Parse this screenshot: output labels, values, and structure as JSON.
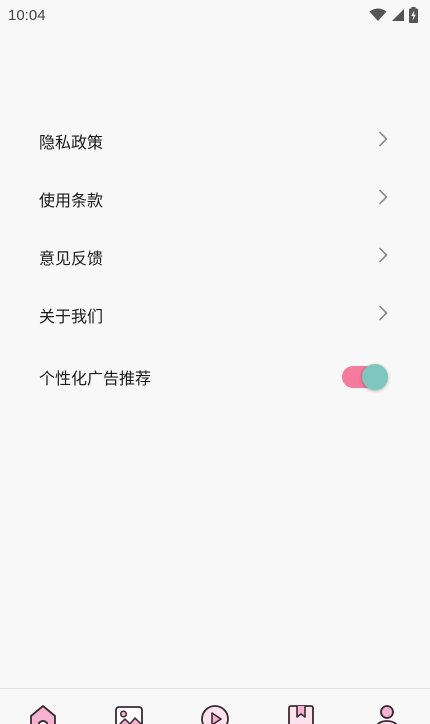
{
  "status_bar": {
    "time": "10:04",
    "icons": [
      "wifi-icon",
      "cellular-signal-icon",
      "battery-charging-icon"
    ]
  },
  "menu": {
    "items": [
      {
        "label": "隐私政策",
        "icon": "chevron-right-icon"
      },
      {
        "label": "使用条款",
        "icon": "chevron-right-icon"
      },
      {
        "label": "意见反馈",
        "icon": "chevron-right-icon"
      },
      {
        "label": "关于我们",
        "icon": "chevron-right-icon"
      }
    ],
    "toggle_item": {
      "label": "个性化广告推荐",
      "enabled": true
    }
  },
  "colors": {
    "toggle_track": "#f47a9e",
    "toggle_knob": "#7fc6bf",
    "icon_stroke": "#3a2a33",
    "icon_fill": "#f6b3cf",
    "chevron": "#8a8a8a"
  },
  "tab_bar": {
    "tabs": [
      {
        "icon": "home-icon"
      },
      {
        "icon": "image-gallery-icon"
      },
      {
        "icon": "play-video-icon"
      },
      {
        "icon": "bookmark-book-icon"
      },
      {
        "icon": "profile-icon"
      }
    ]
  }
}
